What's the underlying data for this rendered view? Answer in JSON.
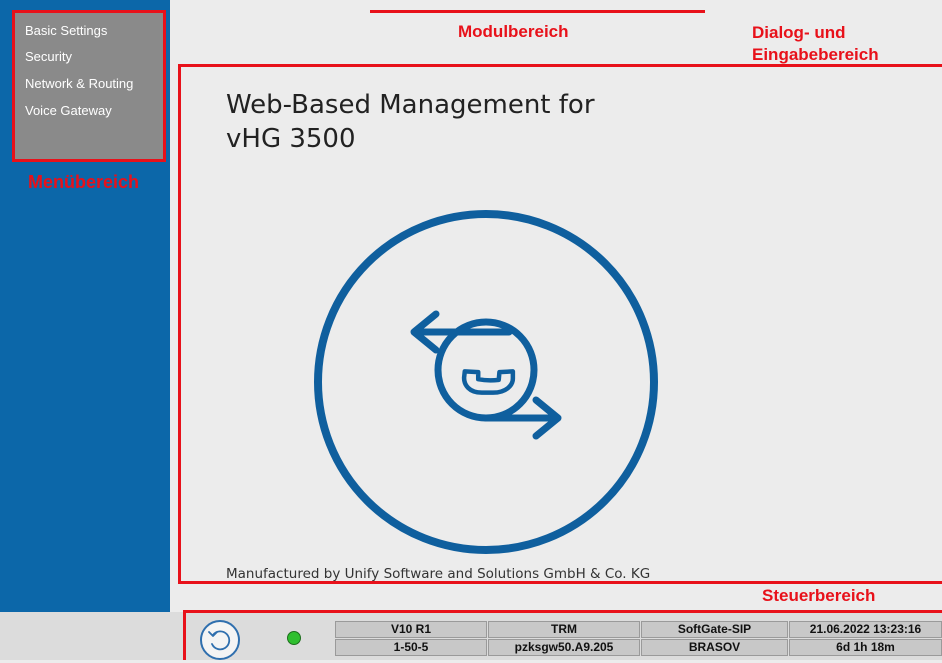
{
  "menu": {
    "items": [
      "Basic Settings",
      "Security",
      "Network & Routing",
      "Voice Gateway"
    ],
    "area_label": "Menübereich"
  },
  "labels": {
    "module_area": "Modulbereich",
    "dialog_area_line1": "Dialog- und",
    "dialog_area_line2": "Eingabebereich",
    "control_area": "Steuerbereich"
  },
  "main": {
    "title_line1": "Web-Based Management for",
    "title_line2": "vHG 3500",
    "manufacturer": "Manufactured by Unify Software and Solutions GmbH & Co. KG"
  },
  "status": {
    "row1": [
      "V10 R1",
      "TRM",
      "SoftGate-SIP",
      "21.06.2022 13:23:16"
    ],
    "row2": [
      "1-50-5",
      "pzksgw50.A9.205",
      "BRASOV",
      "6d 1h 18m"
    ],
    "led_color": "#2fbf2f"
  },
  "colors": {
    "accent_red": "#e8111a",
    "sidebar_blue": "#0c67a9",
    "logo_blue": "#0f5f9e"
  }
}
